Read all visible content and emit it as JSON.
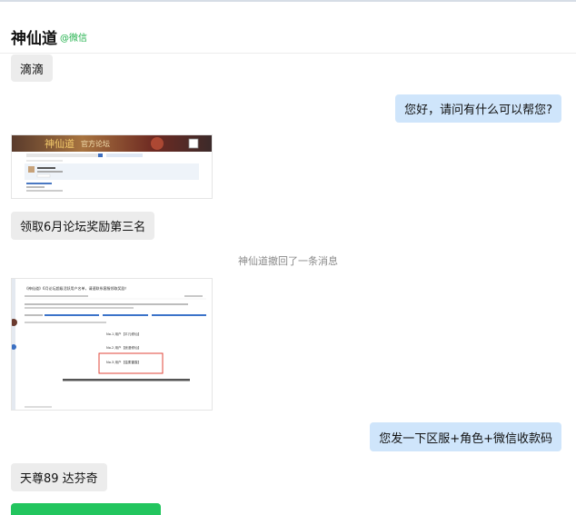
{
  "header": {
    "title": "神仙道",
    "source_tag": "@微信"
  },
  "messages": {
    "m1": "滴滴",
    "m2": "您好，请问有什么可以帮您?",
    "m3": "领取6月论坛奖励第三名",
    "system_recall": "神仙道撤回了一条消息",
    "m4": "您发一下区服+角色+微信收款码",
    "m5": "天尊89 达芬奇"
  },
  "images": {
    "forum_banner_title": "官方论坛",
    "forum_logo_text": "神仙道",
    "post_title": "《神仙道》6月论坛超级活跃用户名单，请速联系客服领取奖励！",
    "rank1": "No.1 用户【平凡修仙】",
    "rank2": "No.2 用户【浪漫修仙】",
    "rank3": "No.3 用户【温柔雷霆】"
  },
  "colors": {
    "green_tag": "#22b14c",
    "bubble_right": "#cfe5fb",
    "bubble_left": "#ececec"
  }
}
